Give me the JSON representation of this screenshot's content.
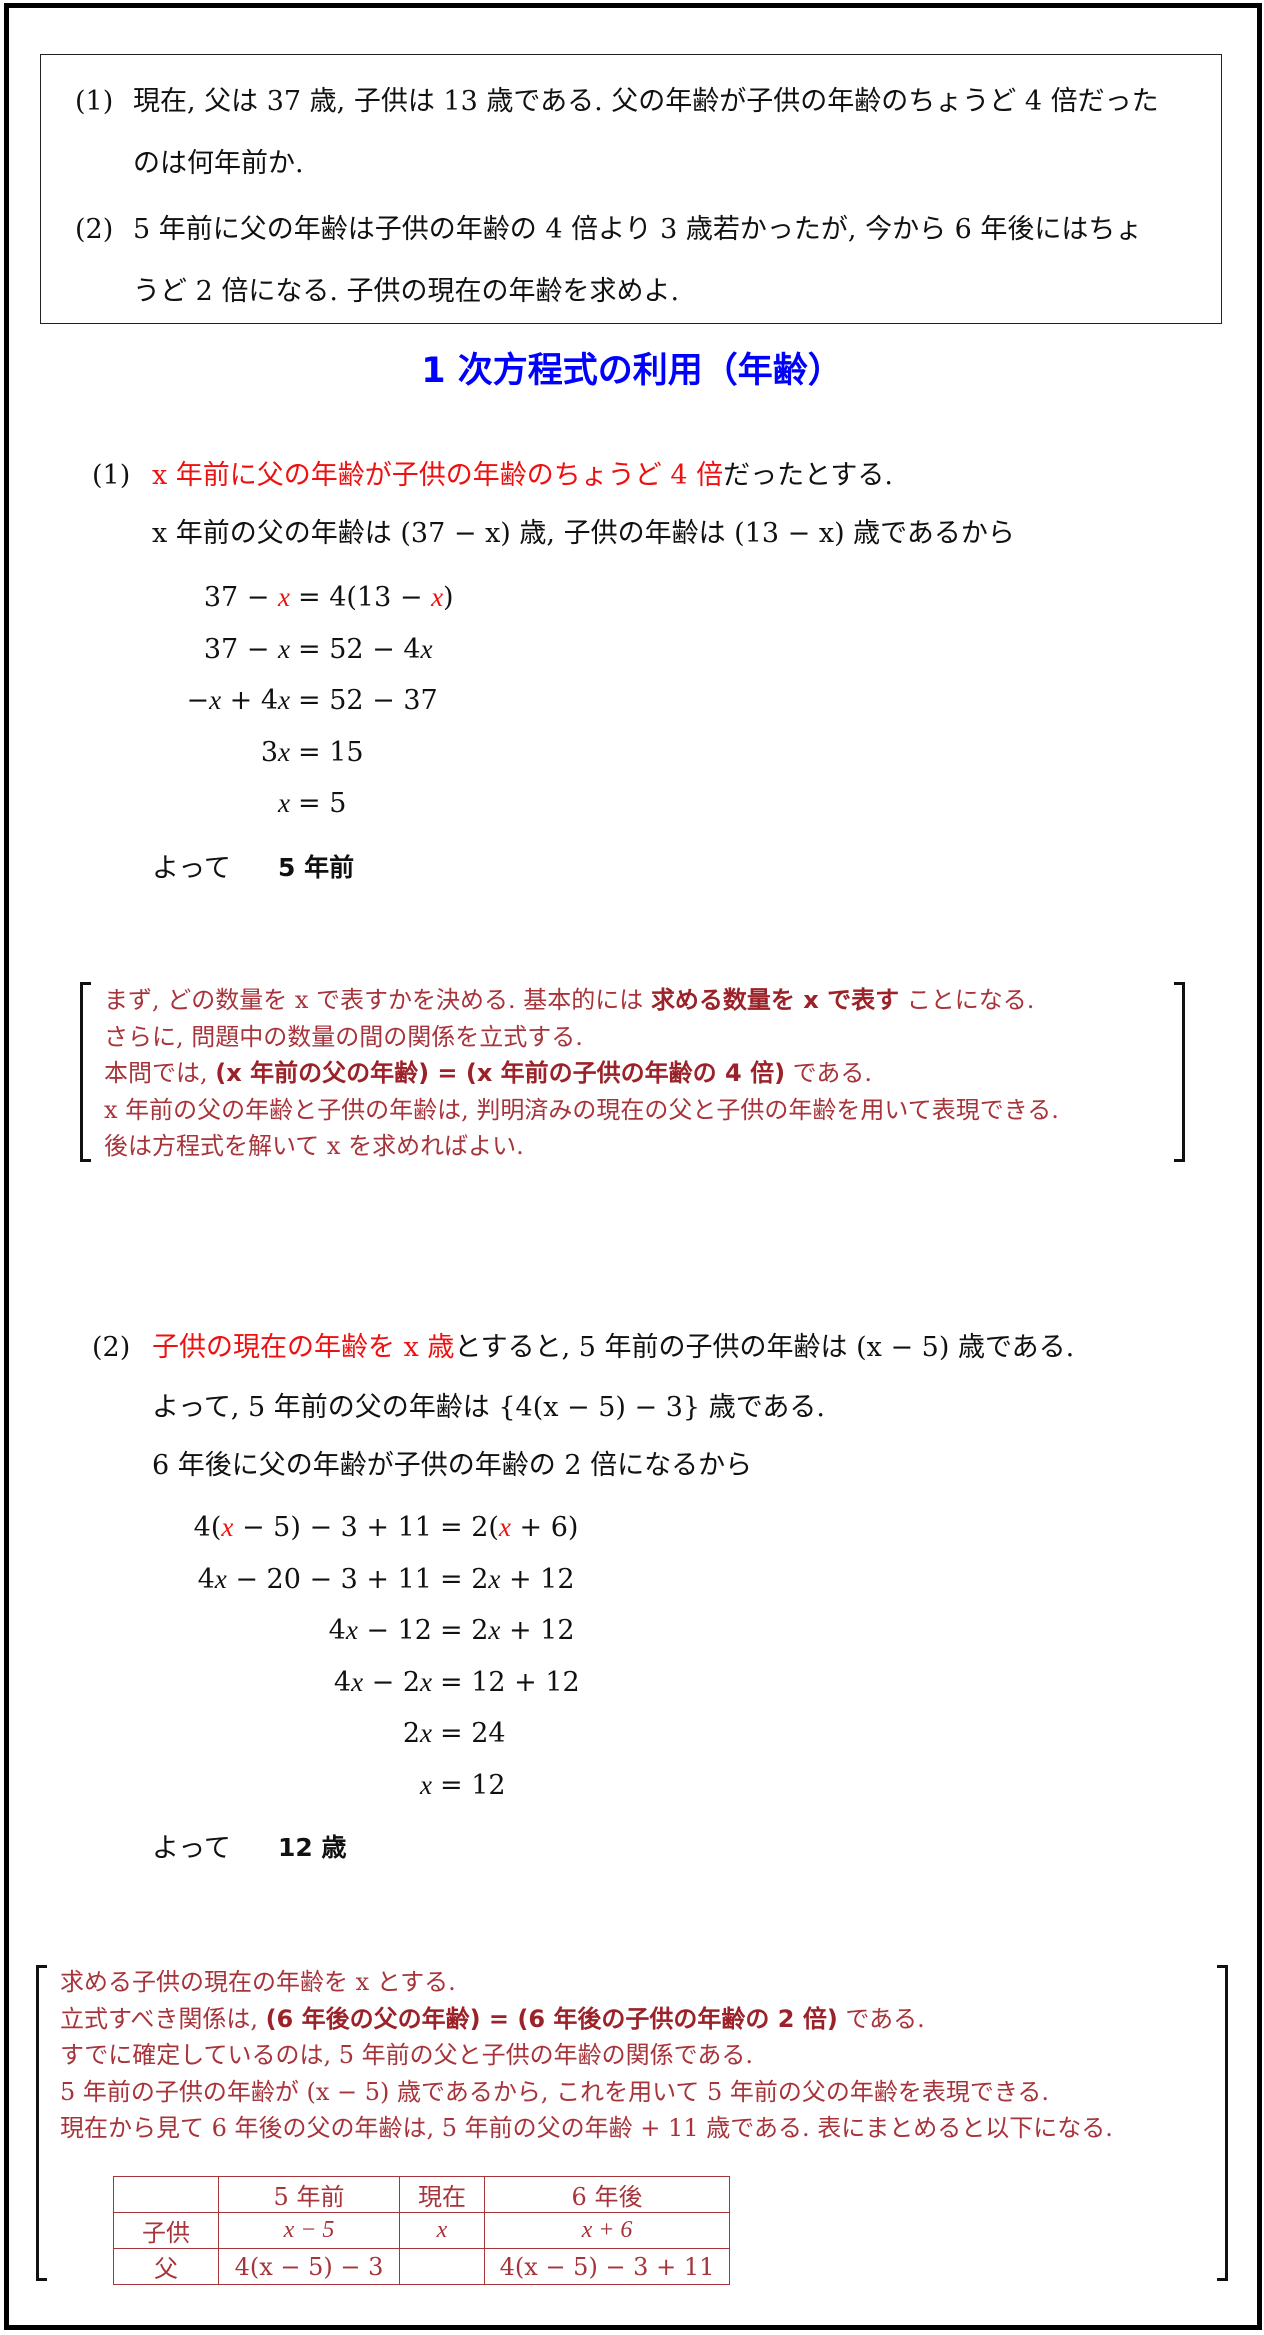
{
  "problems": [
    {
      "num": "(1)",
      "line1": "現在, 父は 37 歳, 子供は 13 歳である. 父の年齢が子供の年齢のちょうど 4 倍だった",
      "line2": "のは何年前か."
    },
    {
      "num": "(2)",
      "line1": "5 年前に父の年齢は子供の年齢の 4 倍より 3 歳若かったが, 今から 6 年後にはちょ",
      "line2": "うど 2 倍になる. 子供の現在の年齢を求めよ."
    }
  ],
  "title": "1 次方程式の利用（年齢）",
  "solution1": {
    "num": "(1)",
    "intro_red": "x 年前に父の年齢が子供の年齢のちょうど 4 倍",
    "intro_black": "だったとする.",
    "line2": "x 年前の父の年齢は (37 − x) 歳, 子供の年齢は (13 − x) 歳であるから",
    "equations": [
      {
        "lhs": "37 − x",
        "rhs": "= 4(13 − x)"
      },
      {
        "lhs": "37 − x",
        "rhs": "= 52 − 4x"
      },
      {
        "lhs": "−x + 4x",
        "rhs": "= 52 − 37"
      },
      {
        "lhs": "3x",
        "rhs": "= 15"
      },
      {
        "lhs": "x",
        "rhs": "= 5"
      }
    ],
    "answer_prefix": "よって",
    "answer": "5 年前"
  },
  "note1": {
    "lines": [
      {
        "pre": "まず, どの数量を x で表すかを決める. 基本的には ",
        "bold": "求める数量を x で表す",
        "post": " ことになる."
      },
      {
        "pre": "さらに, 問題中の数量の間の関係を立式する.",
        "bold": "",
        "post": ""
      },
      {
        "pre": "本問では, ",
        "bold": "(x 年前の父の年齢) = (x 年前の子供の年齢の 4 倍)",
        "post": " である."
      },
      {
        "pre": "x 年前の父の年齢と子供の年齢は, 判明済みの現在の父と子供の年齢を用いて表現できる.",
        "bold": "",
        "post": ""
      },
      {
        "pre": "後は方程式を解いて x を求めればよい.",
        "bold": "",
        "post": ""
      }
    ]
  },
  "solution2": {
    "num": "(2)",
    "intro_red": "子供の現在の年齢を x 歳",
    "intro_black": "とすると, 5 年前の子供の年齢は (x − 5) 歳である.",
    "line2": "よって, 5 年前の父の年齢は {4(x − 5) − 3} 歳である.",
    "line3": "6 年後に父の年齢が子供の年齢の 2 倍になるから",
    "equations": [
      {
        "lhs": "4(x − 5) − 3 + 11",
        "rhs": "= 2(x + 6)"
      },
      {
        "lhs": "4x − 20 − 3 + 11",
        "rhs": "= 2x + 12"
      },
      {
        "lhs": "4x − 12",
        "rhs": "= 2x + 12"
      },
      {
        "lhs": "4x − 2x",
        "rhs": "= 12 + 12"
      },
      {
        "lhs": "2x",
        "rhs": "= 24"
      },
      {
        "lhs": "x",
        "rhs": "= 12"
      }
    ],
    "answer_prefix": "よって",
    "answer": "12 歳"
  },
  "note2": {
    "lines": [
      {
        "pre": "求める子供の現在の年齢を x とする.",
        "bold": "",
        "post": ""
      },
      {
        "pre": "立式すべき関係は, ",
        "bold": "(6 年後の父の年齢) = (6 年後の子供の年齢の 2 倍)",
        "post": " である."
      },
      {
        "pre": "すでに確定しているのは, 5 年前の父と子供の年齢の関係である.",
        "bold": "",
        "post": ""
      },
      {
        "pre": "5 年前の子供の年齢が (x − 5) 歳であるから, これを用いて 5 年前の父の年齢を表現できる.",
        "bold": "",
        "post": ""
      },
      {
        "pre": "現在から見て 6 年後の父の年齢は, 5 年前の父の年齢 + 11 歳である. 表にまとめると以下になる.",
        "bold": "",
        "post": ""
      }
    ],
    "table": {
      "headers": [
        "",
        "5 年前",
        "現在",
        "6 年後"
      ],
      "rows": [
        [
          "子供",
          "x − 5",
          "x",
          "x + 6"
        ],
        [
          "父",
          "4(x − 5) − 3",
          "",
          "4(x − 5) − 3 + 11"
        ]
      ]
    }
  }
}
